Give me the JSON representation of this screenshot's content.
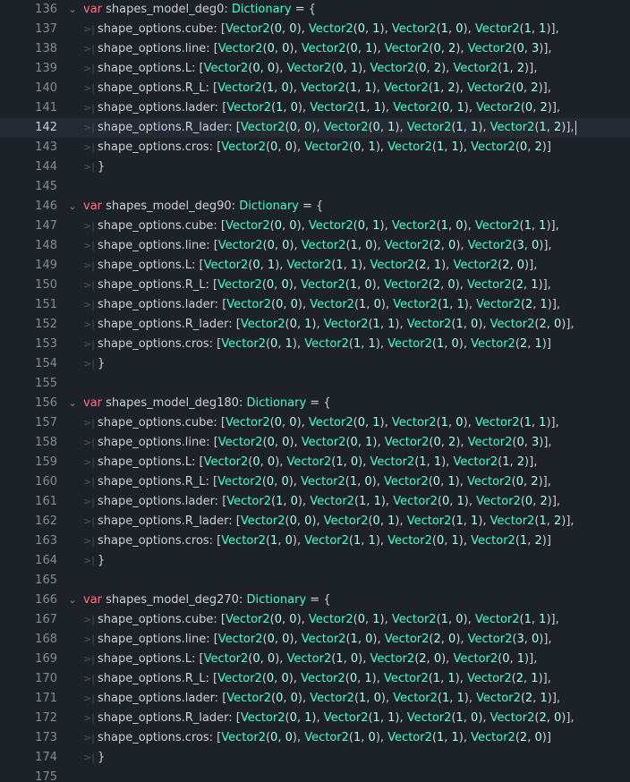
{
  "editor": {
    "keyword_var": "var",
    "type_dictionary": "Dictionary",
    "type_vector": "Vector2",
    "prefix": "shape_options.",
    "current_line": 142,
    "fold_icon": "chevron-down-icon",
    "tab_icon": "tab-indent-icon",
    "colors": {
      "background": "#1d2229",
      "keyword": "#ff7085",
      "type": "#42ffc2",
      "number": "#a1ffe0",
      "text": "#cdcfd2",
      "line_number": "#878b91"
    }
  },
  "blocks": [
    {
      "decl_line": 136,
      "var_name": "shapes_model_deg0",
      "entries": [
        {
          "line": 137,
          "key": "cube",
          "vecs": [
            [
              0,
              0
            ],
            [
              0,
              1
            ],
            [
              1,
              0
            ],
            [
              1,
              1
            ]
          ],
          "trail": "],"
        },
        {
          "line": 138,
          "key": "line",
          "vecs": [
            [
              0,
              0
            ],
            [
              0,
              1
            ],
            [
              0,
              2
            ],
            [
              0,
              3
            ]
          ],
          "trail": "],"
        },
        {
          "line": 139,
          "key": "L",
          "vecs": [
            [
              0,
              0
            ],
            [
              0,
              1
            ],
            [
              0,
              2
            ],
            [
              1,
              2
            ]
          ],
          "trail": "],"
        },
        {
          "line": 140,
          "key": "R_L",
          "vecs": [
            [
              1,
              0
            ],
            [
              1,
              1
            ],
            [
              1,
              2
            ],
            [
              0,
              2
            ]
          ],
          "trail": "],"
        },
        {
          "line": 141,
          "key": "lader",
          "vecs": [
            [
              1,
              0
            ],
            [
              1,
              1
            ],
            [
              0,
              1
            ],
            [
              0,
              2
            ]
          ],
          "trail": "],"
        },
        {
          "line": 142,
          "key": "R_lader",
          "vecs": [
            [
              0,
              0
            ],
            [
              0,
              1
            ],
            [
              1,
              1
            ],
            [
              1,
              2
            ]
          ],
          "trail": "],"
        },
        {
          "line": 143,
          "key": "cros",
          "vecs": [
            [
              0,
              0
            ],
            [
              0,
              1
            ],
            [
              1,
              1
            ],
            [
              0,
              2
            ]
          ],
          "trail": "]"
        }
      ],
      "close_line": 144,
      "blank_line": 145
    },
    {
      "decl_line": 146,
      "var_name": "shapes_model_deg90",
      "entries": [
        {
          "line": 147,
          "key": "cube",
          "vecs": [
            [
              0,
              0
            ],
            [
              0,
              1
            ],
            [
              1,
              0
            ],
            [
              1,
              1
            ]
          ],
          "trail": "],"
        },
        {
          "line": 148,
          "key": "line",
          "vecs": [
            [
              0,
              0
            ],
            [
              1,
              0
            ],
            [
              2,
              0
            ],
            [
              3,
              0
            ]
          ],
          "trail": "],"
        },
        {
          "line": 149,
          "key": "L",
          "vecs": [
            [
              0,
              1
            ],
            [
              1,
              1
            ],
            [
              2,
              1
            ],
            [
              2,
              0
            ]
          ],
          "trail": "],"
        },
        {
          "line": 150,
          "key": "R_L",
          "vecs": [
            [
              0,
              0
            ],
            [
              1,
              0
            ],
            [
              2,
              0
            ],
            [
              2,
              1
            ]
          ],
          "trail": "],"
        },
        {
          "line": 151,
          "key": "lader",
          "vecs": [
            [
              0,
              0
            ],
            [
              1,
              0
            ],
            [
              1,
              1
            ],
            [
              2,
              1
            ]
          ],
          "trail": "],"
        },
        {
          "line": 152,
          "key": "R_lader",
          "vecs": [
            [
              0,
              1
            ],
            [
              1,
              1
            ],
            [
              1,
              0
            ],
            [
              2,
              0
            ]
          ],
          "trail": "],"
        },
        {
          "line": 153,
          "key": "cros",
          "vecs": [
            [
              0,
              1
            ],
            [
              1,
              1
            ],
            [
              1,
              0
            ],
            [
              2,
              1
            ]
          ],
          "trail": "]"
        }
      ],
      "close_line": 154,
      "blank_line": 155
    },
    {
      "decl_line": 156,
      "var_name": "shapes_model_deg180",
      "entries": [
        {
          "line": 157,
          "key": "cube",
          "vecs": [
            [
              0,
              0
            ],
            [
              0,
              1
            ],
            [
              1,
              0
            ],
            [
              1,
              1
            ]
          ],
          "trail": "],"
        },
        {
          "line": 158,
          "key": "line",
          "vecs": [
            [
              0,
              0
            ],
            [
              0,
              1
            ],
            [
              0,
              2
            ],
            [
              0,
              3
            ]
          ],
          "trail": "],"
        },
        {
          "line": 159,
          "key": "L",
          "vecs": [
            [
              0,
              0
            ],
            [
              1,
              0
            ],
            [
              1,
              1
            ],
            [
              1,
              2
            ]
          ],
          "trail": "],"
        },
        {
          "line": 160,
          "key": "R_L",
          "vecs": [
            [
              0,
              0
            ],
            [
              1,
              0
            ],
            [
              0,
              1
            ],
            [
              0,
              2
            ]
          ],
          "trail": "],"
        },
        {
          "line": 161,
          "key": "lader",
          "vecs": [
            [
              1,
              0
            ],
            [
              1,
              1
            ],
            [
              0,
              1
            ],
            [
              0,
              2
            ]
          ],
          "trail": "],"
        },
        {
          "line": 162,
          "key": "R_lader",
          "vecs": [
            [
              0,
              0
            ],
            [
              0,
              1
            ],
            [
              1,
              1
            ],
            [
              1,
              2
            ]
          ],
          "trail": "],"
        },
        {
          "line": 163,
          "key": "cros",
          "vecs": [
            [
              1,
              0
            ],
            [
              1,
              1
            ],
            [
              0,
              1
            ],
            [
              1,
              2
            ]
          ],
          "trail": "]"
        }
      ],
      "close_line": 164,
      "blank_line": 165
    },
    {
      "decl_line": 166,
      "var_name": "shapes_model_deg270",
      "entries": [
        {
          "line": 167,
          "key": "cube",
          "vecs": [
            [
              0,
              0
            ],
            [
              0,
              1
            ],
            [
              1,
              0
            ],
            [
              1,
              1
            ]
          ],
          "trail": "],"
        },
        {
          "line": 168,
          "key": "line",
          "vecs": [
            [
              0,
              0
            ],
            [
              1,
              0
            ],
            [
              2,
              0
            ],
            [
              3,
              0
            ]
          ],
          "trail": "],"
        },
        {
          "line": 169,
          "key": "L",
          "vecs": [
            [
              0,
              0
            ],
            [
              1,
              0
            ],
            [
              2,
              0
            ],
            [
              0,
              1
            ]
          ],
          "trail": "],"
        },
        {
          "line": 170,
          "key": "R_L",
          "vecs": [
            [
              0,
              0
            ],
            [
              0,
              1
            ],
            [
              1,
              1
            ],
            [
              2,
              1
            ]
          ],
          "trail": "],"
        },
        {
          "line": 171,
          "key": "lader",
          "vecs": [
            [
              0,
              0
            ],
            [
              1,
              0
            ],
            [
              1,
              1
            ],
            [
              2,
              1
            ]
          ],
          "trail": "],"
        },
        {
          "line": 172,
          "key": "R_lader",
          "vecs": [
            [
              0,
              1
            ],
            [
              1,
              1
            ],
            [
              1,
              0
            ],
            [
              2,
              0
            ]
          ],
          "trail": "],"
        },
        {
          "line": 173,
          "key": "cros",
          "vecs": [
            [
              0,
              0
            ],
            [
              1,
              0
            ],
            [
              1,
              1
            ],
            [
              2,
              0
            ]
          ],
          "trail": "]"
        }
      ],
      "close_line": 174,
      "blank_line": 175
    }
  ]
}
